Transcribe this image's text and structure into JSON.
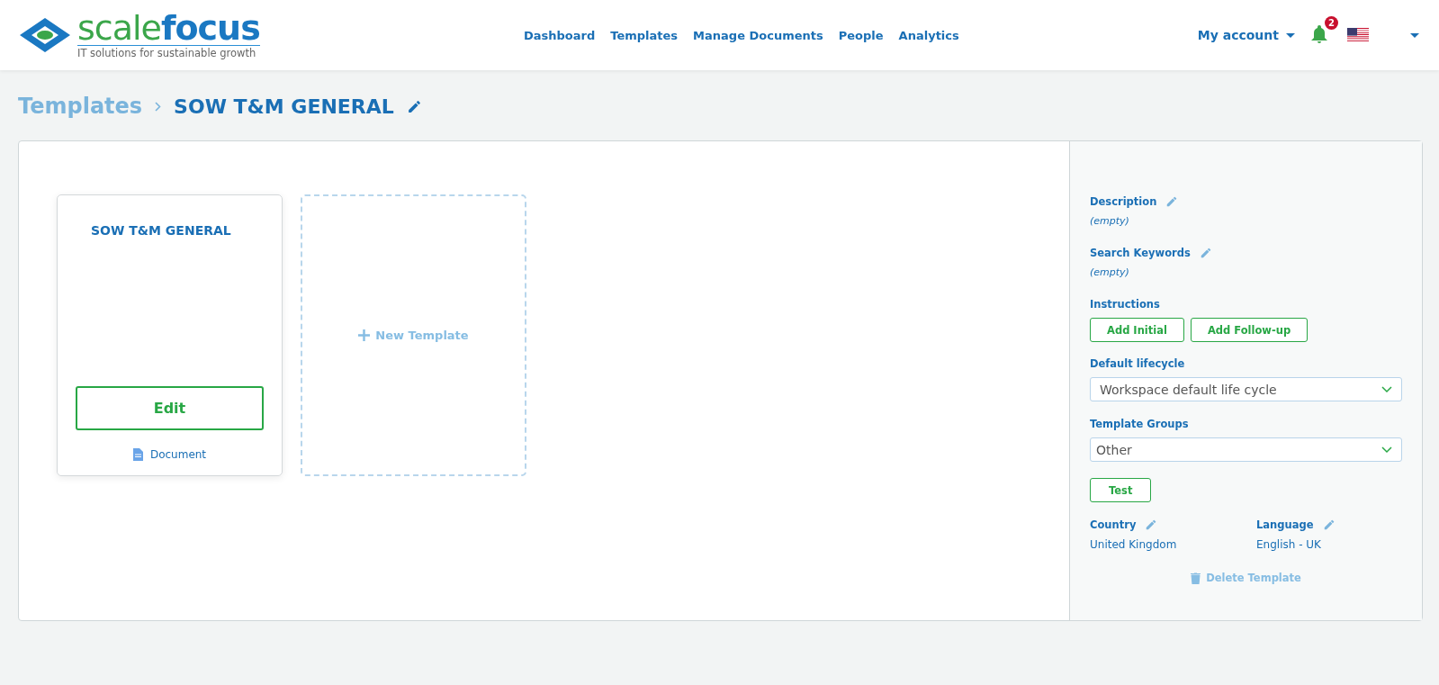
{
  "logo": {
    "word_1": "scale",
    "word_2": "focus",
    "tagline": "IT solutions for sustainable growth"
  },
  "nav": [
    {
      "label": "Dashboard"
    },
    {
      "label": "Templates"
    },
    {
      "label": "Manage Documents"
    },
    {
      "label": "People"
    },
    {
      "label": "Analytics"
    }
  ],
  "account": {
    "label": "My account",
    "notifications": "2"
  },
  "breadcrumb": {
    "parent": "Templates",
    "current": "SOW T&M GENERAL"
  },
  "template_cards": [
    {
      "title": "SOW T&M GENERAL",
      "button": "Edit",
      "type": "Document"
    }
  ],
  "new_template": "New Template",
  "details": {
    "description": {
      "label": "Description",
      "value": "(empty)"
    },
    "keywords": {
      "label": "Search Keywords",
      "value": "(empty)"
    },
    "instructions": {
      "label": "Instructions",
      "buttons": [
        "Add Initial",
        "Add Follow-up"
      ]
    },
    "lifecycle": {
      "label": "Default lifecycle",
      "value": "Workspace default life cycle"
    },
    "groups": {
      "label": "Template Groups",
      "value": "Other"
    },
    "test_button": "Test",
    "country": {
      "label": "Country",
      "value": "United Kingdom"
    },
    "language": {
      "label": "Language",
      "value": "English - UK"
    },
    "delete": "Delete Template"
  }
}
